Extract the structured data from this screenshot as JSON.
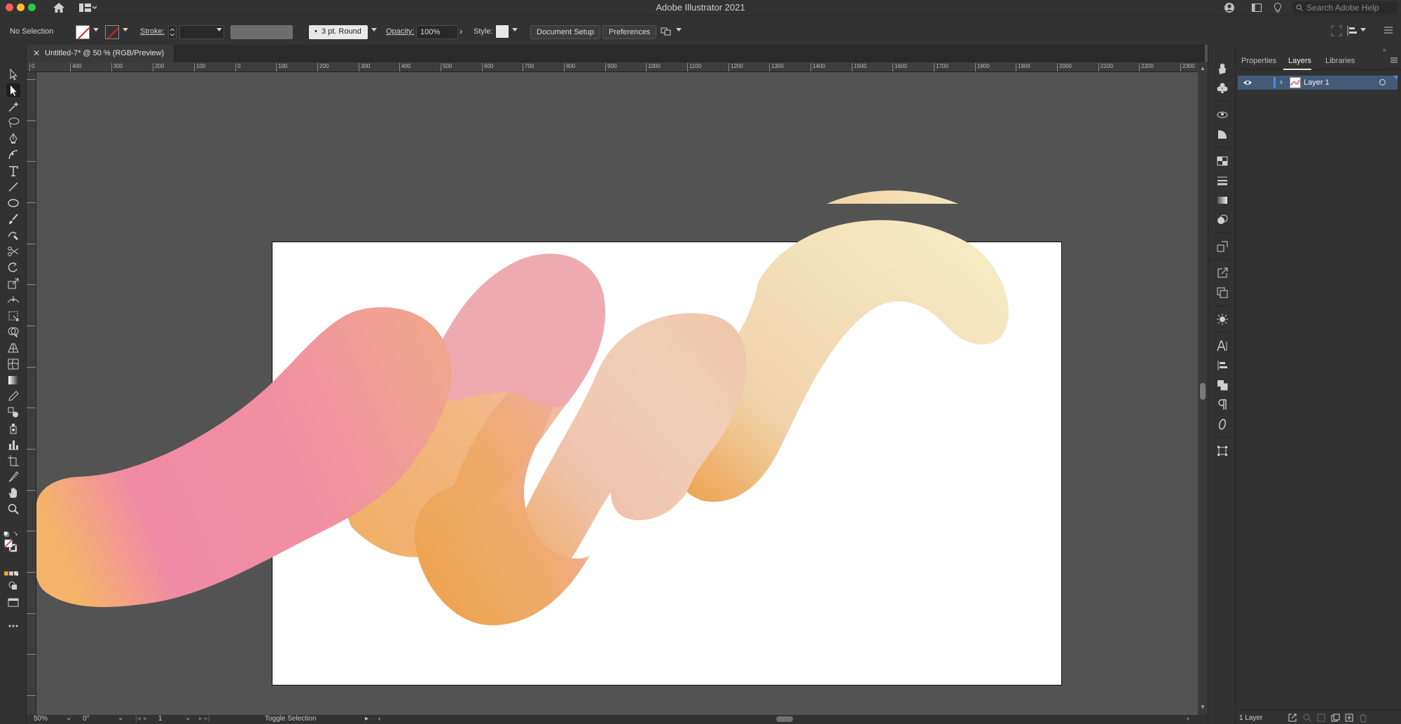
{
  "app": {
    "title": "Adobe Illustrator 2021",
    "search_placeholder": "Search Adobe Help"
  },
  "control_bar": {
    "selection_label": "No Selection",
    "stroke_label": "Stroke:",
    "brush_label": "3 pt. Round",
    "opacity_label": "Opacity:",
    "opacity_value": "100%",
    "style_label": "Style:",
    "document_setup_label": "Document Setup",
    "preferences_label": "Preferences"
  },
  "document": {
    "tab_title": "Untitled-7* @ 50 % (RGB/Preview)",
    "ruler_h_ticks": [
      "0",
      "400",
      "300",
      "200",
      "100",
      "0",
      "100",
      "200",
      "300",
      "400",
      "500",
      "600",
      "700",
      "800",
      "900",
      "1000",
      "1100",
      "1200",
      "1300",
      "1400",
      "1500",
      "1600",
      "1700",
      "1800",
      "1900",
      "2000",
      "2100",
      "2200",
      "2300"
    ]
  },
  "status_bar": {
    "zoom": "50%",
    "rotation": "0°",
    "artboard_number": "1",
    "status_text": "Toggle Selection"
  },
  "layers_panel": {
    "tabs": [
      "Properties",
      "Layers",
      "Libraries"
    ],
    "active_tab": "Layers",
    "layers": [
      {
        "name": "Layer 1"
      }
    ],
    "count_label": "1 Layer"
  },
  "colors": {
    "ui_dark": "#323232",
    "canvas_bg": "#535353",
    "selection_blue": "#435a79",
    "blob_pink": "#ef8aa6",
    "blob_orange": "#eea34b",
    "blob_cream": "#f6ecc2"
  }
}
